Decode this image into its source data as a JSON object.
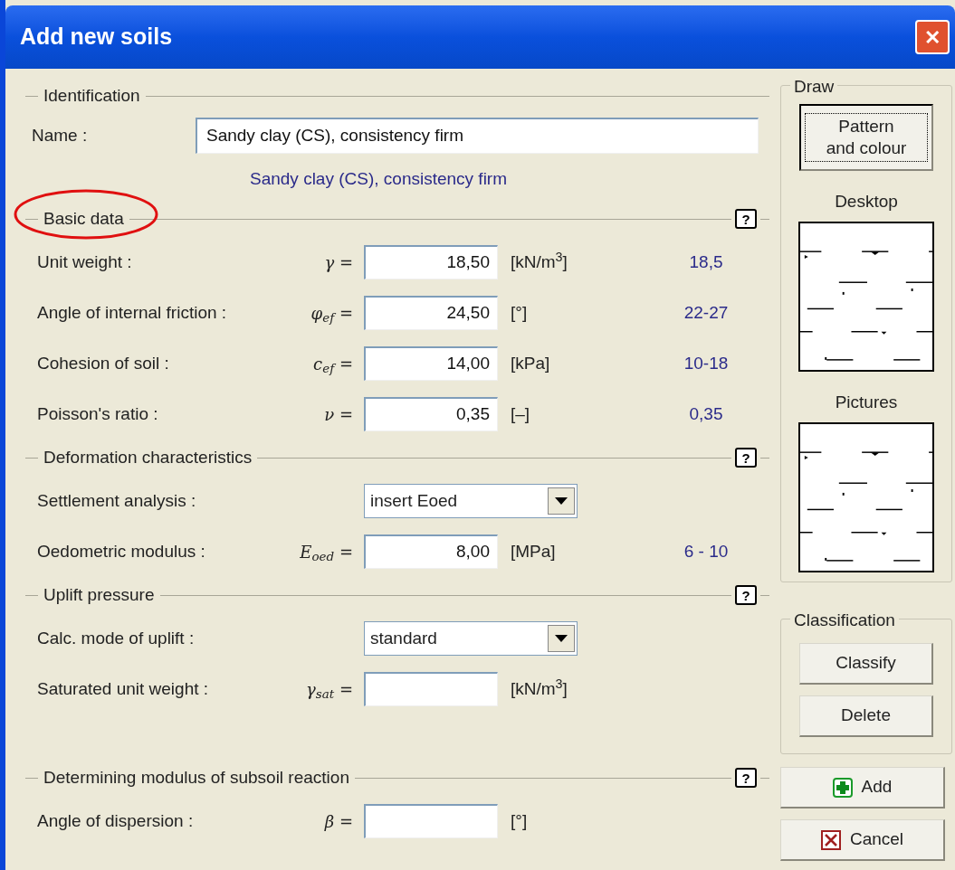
{
  "window": {
    "title": "Add new soils",
    "close": "✕"
  },
  "identification": {
    "title": "Identification",
    "name_label": "Name :",
    "name_value": "Sandy clay (CS), consistency firm",
    "preview": "Sandy clay (CS), consistency firm"
  },
  "sections": [
    {
      "title": "Basic data",
      "circled": true,
      "help_label": "?",
      "rows": [
        {
          "kind": "input",
          "label": "Unit weight :",
          "symbol": "γ =",
          "value": "18,50",
          "unit": "[kN/m$^{3}$]",
          "range": "18,5"
        },
        {
          "kind": "input",
          "label": "Angle of internal friction :",
          "symbol": "φ$_{ef}$ =",
          "value": "24,50",
          "unit": "[°]",
          "range": "22-27"
        },
        {
          "kind": "input",
          "label": "Cohesion of soil :",
          "symbol": "c$_{ef}$ =",
          "value": "14,00",
          "unit": "[kPa]",
          "range": "10-18"
        },
        {
          "kind": "input",
          "label": "Poisson's ratio :",
          "symbol": "ν =",
          "value": "0,35",
          "unit": "[–]",
          "range": "0,35"
        }
      ]
    },
    {
      "title": "Deformation characteristics",
      "help_label": "?",
      "rows": [
        {
          "kind": "select",
          "label": "Settlement analysis :",
          "value": "insert Eoed"
        },
        {
          "kind": "input",
          "label": "Oedometric modulus :",
          "symbol": "E$_{oed}$ =",
          "value": "8,00",
          "unit": "[MPa]",
          "range": "6 - 10"
        }
      ]
    },
    {
      "title": "Uplift pressure",
      "help_label": "?",
      "rows": [
        {
          "kind": "select",
          "label": "Calc. mode of uplift :",
          "value": "standard"
        },
        {
          "kind": "input",
          "label": "Saturated unit weight :",
          "symbol": "γ$_{sat}$ =",
          "unit": "[kN/m$^{3}$]"
        }
      ]
    },
    {
      "title": "Determining modulus of subsoil reaction",
      "help_label": "?",
      "rows": [
        {
          "kind": "input",
          "label": "Angle of dispersion :",
          "symbol": "β =",
          "unit": "[°]"
        }
      ]
    }
  ],
  "draw": {
    "title": "Draw",
    "button": "Pattern\nand colour",
    "previews": [
      "Desktop",
      "Pictures"
    ]
  },
  "classification": {
    "title": "Classification",
    "buttons": [
      "Classify",
      "Delete"
    ]
  },
  "actions": [
    {
      "kind": "add",
      "label": "Add"
    },
    {
      "kind": "cancel",
      "label": "Cancel"
    }
  ]
}
